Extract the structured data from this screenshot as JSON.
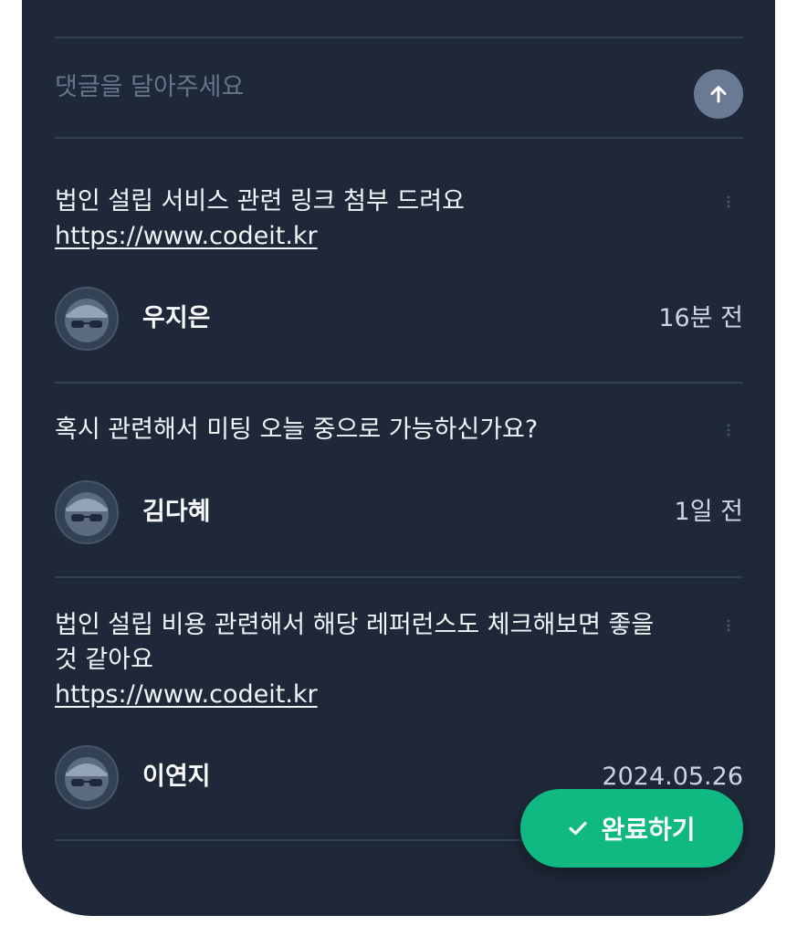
{
  "comment_box": {
    "placeholder": "댓글을 달아주세요",
    "send_icon": "arrow-up-icon"
  },
  "comments": [
    {
      "text_lines": [
        "법인 설립 서비스 관련 링크 첨부 드려요"
      ],
      "link": "https://www.codeit.kr",
      "author": "우지은",
      "time": "16분 전"
    },
    {
      "text_lines": [
        "혹시 관련해서 미팅 오늘 중으로 가능하신가요?"
      ],
      "link": "",
      "author": "김다혜",
      "time": "1일 전"
    },
    {
      "text_lines": [
        "법인 설립 비용 관련해서 해당 레퍼런스도 체크해보면 좋을",
        "것 같아요"
      ],
      "link": "https://www.codeit.kr",
      "author": "이연지",
      "time": "2024.05.26"
    }
  ],
  "complete_button": {
    "label": "완료하기",
    "icon": "check-icon",
    "color": "#10b981"
  },
  "colors": {
    "panel_background": "#1f2838",
    "divider": "#334155",
    "send_button": "#6b7a94"
  }
}
